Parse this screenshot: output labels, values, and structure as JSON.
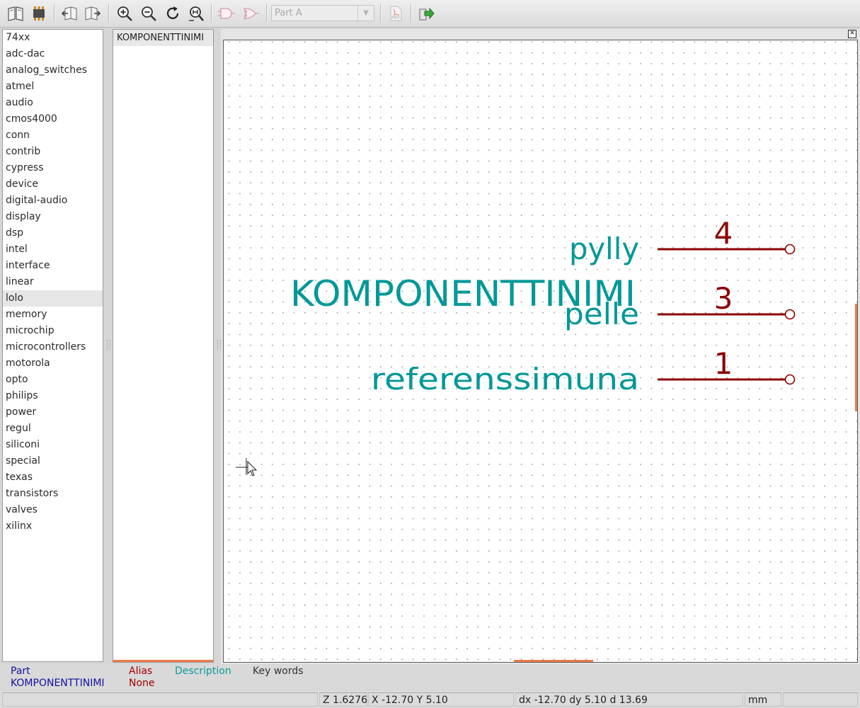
{
  "toolbar": {
    "buttons": [
      {
        "name": "library-browse-icon"
      },
      {
        "name": "component-select-icon"
      },
      {
        "name": "previous-component-icon"
      },
      {
        "name": "next-component-icon"
      },
      {
        "name": "zoom-in-icon"
      },
      {
        "name": "zoom-out-icon"
      },
      {
        "name": "redraw-icon"
      },
      {
        "name": "zoom-fit-icon"
      },
      {
        "name": "body-style-normal-icon"
      },
      {
        "name": "body-style-demorgan-icon"
      },
      {
        "name": "pdf-datasheet-icon"
      },
      {
        "name": "export-to-schematic-icon"
      }
    ],
    "part_select": {
      "value": "Part A"
    }
  },
  "libraries": {
    "selected": "lolo",
    "items": [
      "74xx",
      "adc-dac",
      "analog_switches",
      "atmel",
      "audio",
      "cmos4000",
      "conn",
      "contrib",
      "cypress",
      "device",
      "digital-audio",
      "display",
      "dsp",
      "intel",
      "interface",
      "linear",
      "lolo",
      "memory",
      "microchip",
      "microcontrollers",
      "motorola",
      "opto",
      "philips",
      "power",
      "regul",
      "siliconi",
      "special",
      "texas",
      "transistors",
      "valves",
      "xilinx"
    ]
  },
  "components": {
    "selected": "KOMPONENTTINIMI",
    "items": [
      "KOMPONENTTINIMI"
    ]
  },
  "canvas": {
    "component_name": "KOMPONENTTINIMI",
    "reference": "referenssimuna",
    "pins": [
      {
        "number": "4",
        "name": "pylly"
      },
      {
        "number": "3",
        "name": "pelle"
      },
      {
        "number": "1",
        "name": "referenssimuna"
      }
    ],
    "colors": {
      "field_text": "#009898",
      "pin": "#8e0000",
      "grid": "#9a9a9a"
    }
  },
  "info": {
    "part_label": "Part",
    "part_value": "KOMPONENTTINIMI",
    "alias_label": "Alias",
    "alias_value": "None",
    "description_label": "Description",
    "keywords_label": "Key words",
    "colors": {
      "part": "#1212a0",
      "alias": "#a00000",
      "description": "#0b9a9a",
      "keywords": "#333333"
    }
  },
  "status": {
    "zoom": "Z 1.62765",
    "xy": "X -12.70  Y 5.10",
    "delta": "dx -12.70  dy 5.10  d 13.69",
    "units": "mm"
  }
}
